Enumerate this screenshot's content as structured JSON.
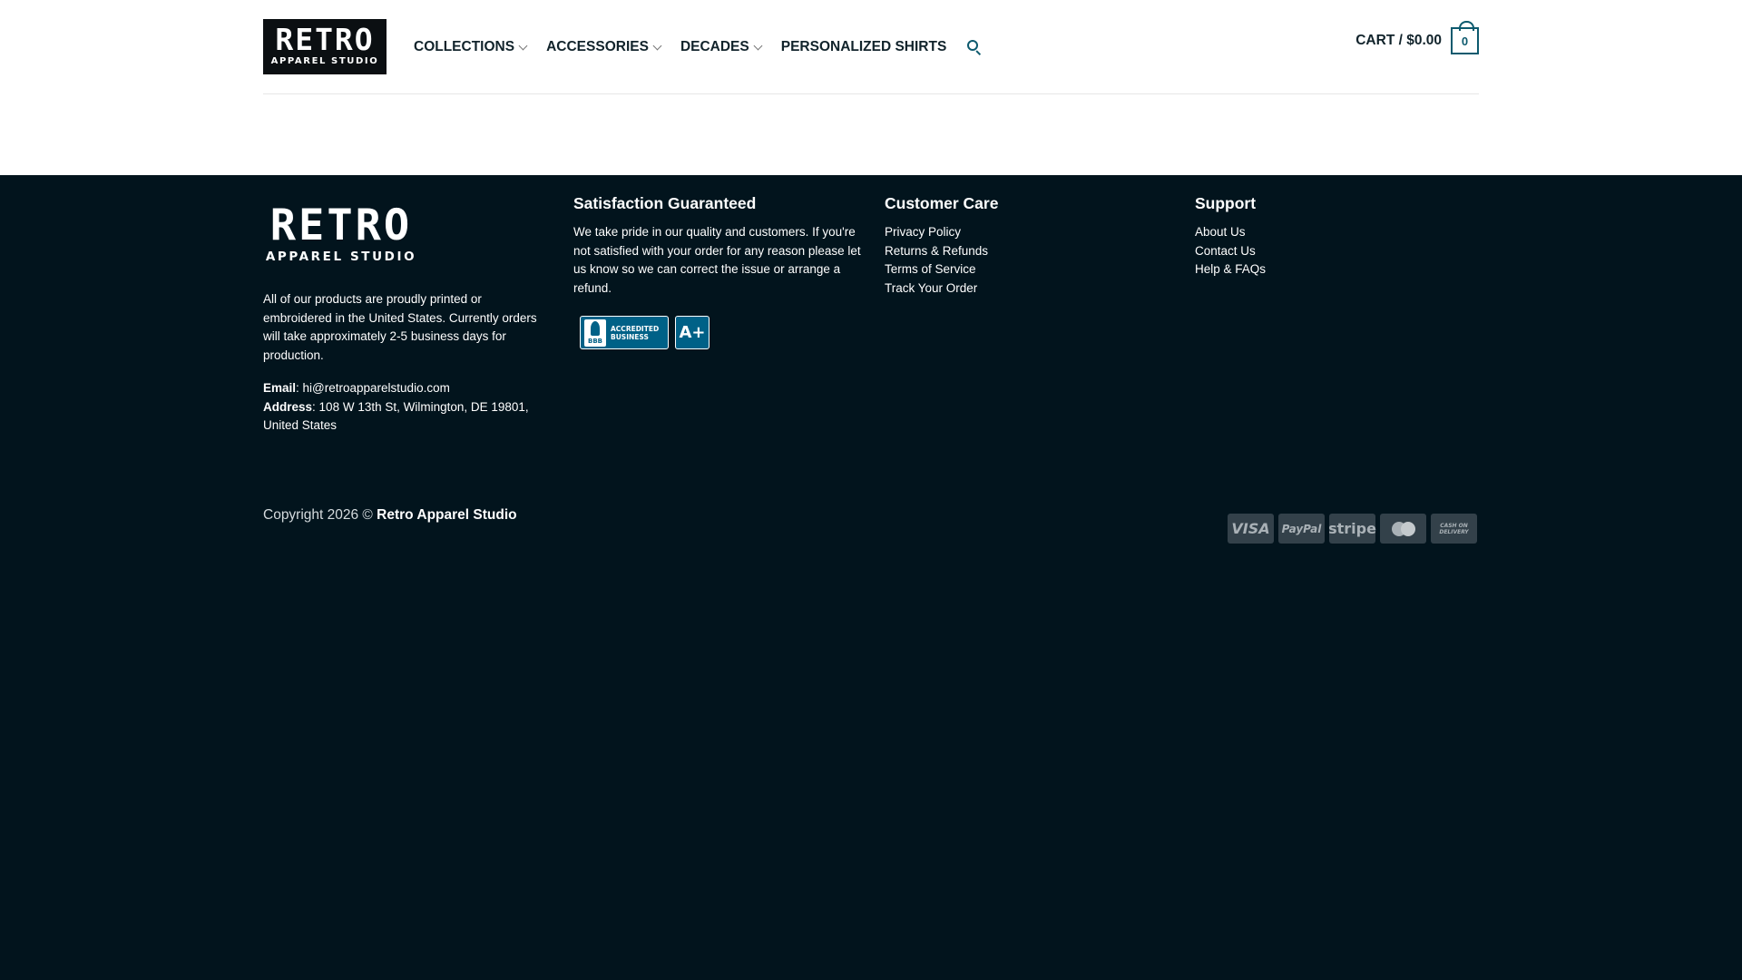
{
  "header": {
    "logo": {
      "line1": "RETRO",
      "line2": "APPAREL STUDIO"
    },
    "nav": [
      {
        "label": "COLLECTIONS",
        "dropdown": true
      },
      {
        "label": "ACCESSORIES",
        "dropdown": true
      },
      {
        "label": "DECADES",
        "dropdown": true
      },
      {
        "label": "PERSONALIZED SHIRTS",
        "dropdown": false
      }
    ],
    "search_icon": "search-icon",
    "cart": {
      "label": "CART / $0.00",
      "count": "0"
    }
  },
  "footer": {
    "logo": {
      "line1": "RETRO",
      "line2": "APPAREL STUDIO"
    },
    "about": {
      "description": "All of our products are proudly printed or embroidered in the United States. Currently orders will take approximately 2-5 business days for production.",
      "email_label": "Email",
      "email": "hi@retroapparelstudio.com",
      "address_label": "Address",
      "address": "108 W 13th St, Wilmington, DE 19801, United States"
    },
    "satisfaction": {
      "title": "Satisfaction Guaranteed",
      "text": "We take pride in our quality and customers. If you're not satisfied with your order for any reason please let us know so we can correct the issue or arrange a refund.",
      "bbb": {
        "mark": "BBB",
        "line1": "ACCREDITED",
        "line2": "BUSINESS",
        "rating": "A+"
      }
    },
    "customer_care": {
      "title": "Customer Care",
      "links": [
        "Privacy Policy",
        "Returns & Refunds",
        "Terms of Service",
        "Track Your Order"
      ]
    },
    "support": {
      "title": "Support",
      "links": [
        "About Us",
        "Contact Us",
        "Help & FAQs"
      ]
    },
    "copyright": {
      "prefix": "Copyright 2026 ©",
      "brand": "Retro Apparel Studio"
    },
    "payments": {
      "visa": "VISA",
      "paypal": "PayPal",
      "stripe": "stripe",
      "mastercard_icon": "mastercard-icon",
      "cod_line1": "CASH ON",
      "cod_line2": "DELIVERY"
    }
  },
  "colors": {
    "accent": "#0d5a6e",
    "footer_bg": "#02141d",
    "header_bg": "#ffffff",
    "text_dark": "#11232b"
  }
}
